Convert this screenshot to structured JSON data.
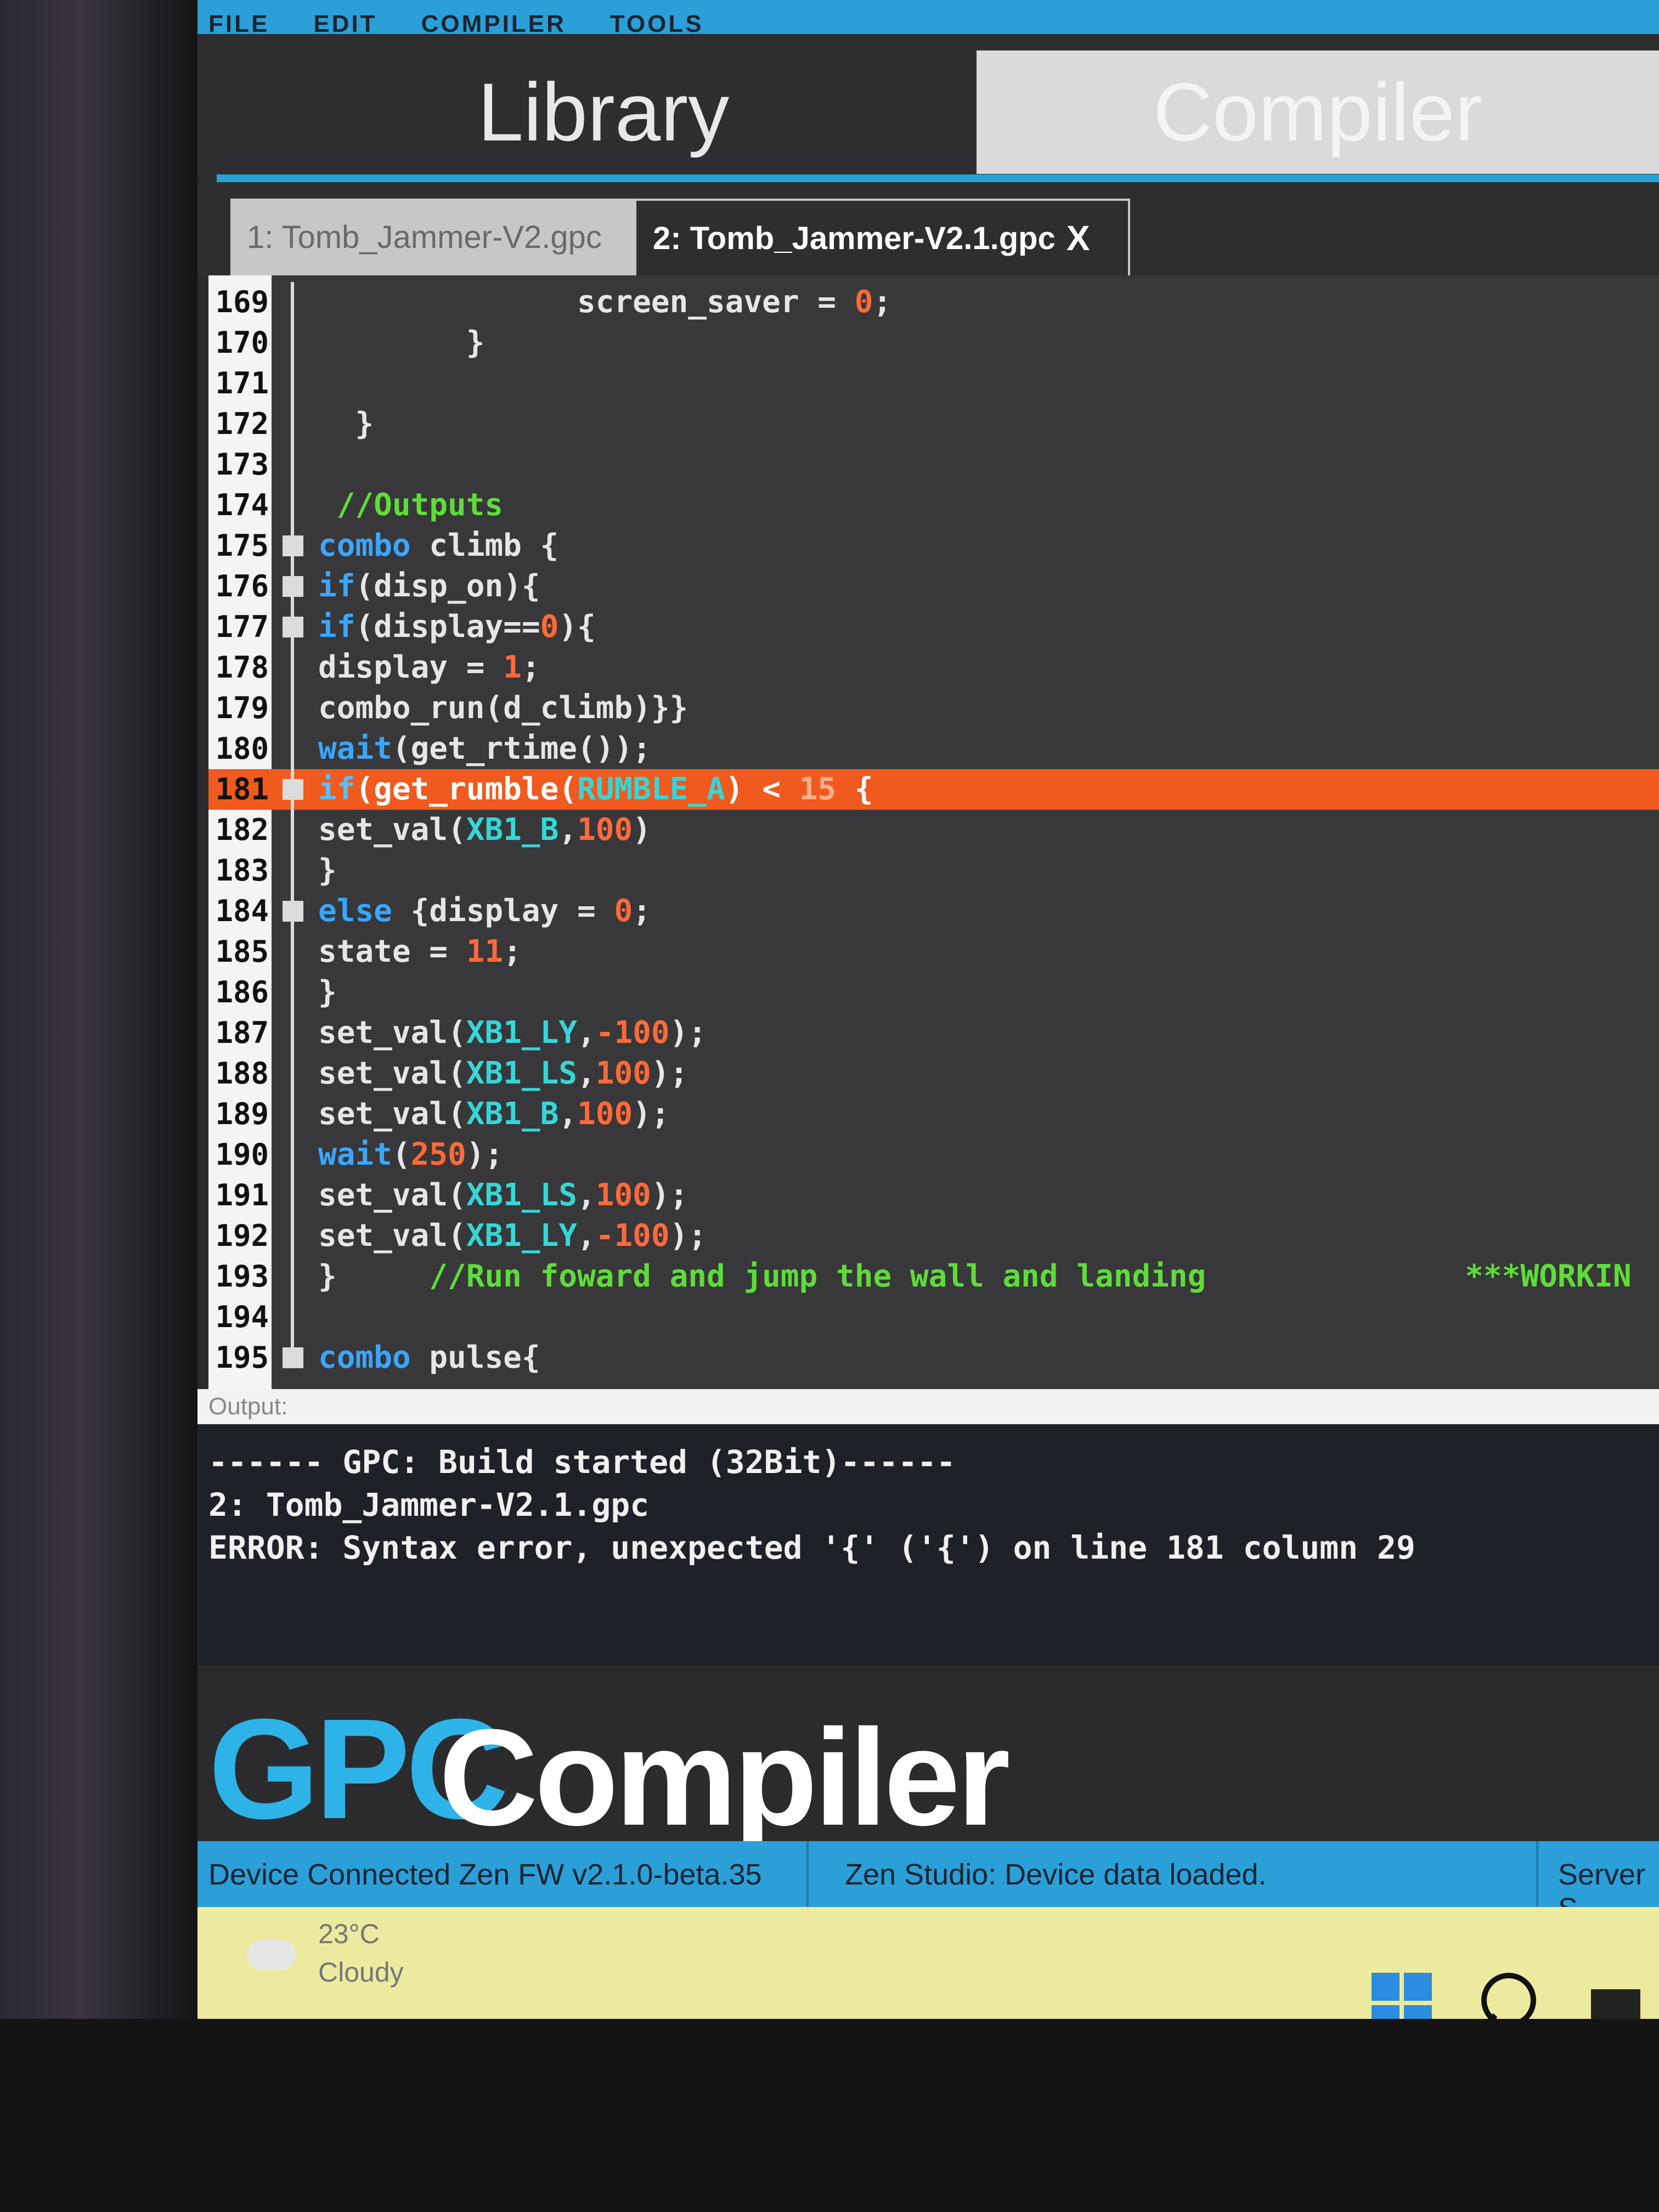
{
  "menu": [
    "FILE",
    "EDIT",
    "COMPILER",
    "TOOLS"
  ],
  "top_tabs": {
    "library": "Library",
    "compiler": "Compiler"
  },
  "file_tabs": {
    "tab1": "1: Tomb_Jammer-V2.gpc",
    "tab2": "2: Tomb_Jammer-V2.1.gpc",
    "close": "X"
  },
  "code": [
    {
      "n": "169",
      "t": "              screen_saver = 0;"
    },
    {
      "n": "170",
      "t": "        }"
    },
    {
      "n": "171",
      "t": ""
    },
    {
      "n": "172",
      "t": "  }"
    },
    {
      "n": "173",
      "t": ""
    },
    {
      "n": "174",
      "t": " //Outputs"
    },
    {
      "n": "175",
      "t": "combo climb {"
    },
    {
      "n": "176",
      "t": "if(disp_on){"
    },
    {
      "n": "177",
      "t": "if(display==0){"
    },
    {
      "n": "178",
      "t": "display = 1;"
    },
    {
      "n": "179",
      "t": "combo_run(d_climb)}}"
    },
    {
      "n": "180",
      "t": "wait(get_rtime());"
    },
    {
      "n": "181",
      "t": "if(get_rumble(RUMBLE_A) < 15 {"
    },
    {
      "n": "182",
      "t": "set_val(XB1_B,100)"
    },
    {
      "n": "183",
      "t": "}"
    },
    {
      "n": "184",
      "t": "else {display = 0;"
    },
    {
      "n": "185",
      "t": "state = 11;"
    },
    {
      "n": "186",
      "t": "}"
    },
    {
      "n": "187",
      "t": "set_val(XB1_LY,-100);"
    },
    {
      "n": "188",
      "t": "set_val(XB1_LS,100);"
    },
    {
      "n": "189",
      "t": "set_val(XB1_B,100);"
    },
    {
      "n": "190",
      "t": "wait(250);"
    },
    {
      "n": "191",
      "t": "set_val(XB1_LS,100);"
    },
    {
      "n": "192",
      "t": "set_val(XB1_LY,-100);"
    },
    {
      "n": "193",
      "t": "}     //Run foward and jump the wall and landing              ***WORKIN"
    },
    {
      "n": "194",
      "t": ""
    },
    {
      "n": "195",
      "t": "combo pulse{"
    }
  ],
  "output": {
    "label": "Output:",
    "line1": "------ GPC: Build started (32Bit)------",
    "line2": "2: Tomb_Jammer-V2.1.gpc",
    "line3": "ERROR: Syntax error, unexpected '{' ('{') on line 181 column 29"
  },
  "brand": {
    "gpc": "GPC",
    "compiler": "Compiler"
  },
  "status": {
    "device": "Device Connected Zen FW v2.1.0-beta.35",
    "zen": "Zen Studio: Device data loaded.",
    "server": "Server S"
  },
  "weather": {
    "temp": "23°C",
    "cond": "Cloudy"
  },
  "colors": {
    "accent": "#2a9fd8",
    "highlight_line": "#f05a1e",
    "keyword": "#3aa6ff",
    "number": "#ff6a3a",
    "comment": "#5fdc3a"
  }
}
